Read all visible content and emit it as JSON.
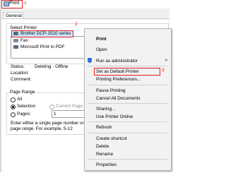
{
  "window": {
    "title": "Print"
  },
  "callouts": {
    "one": "1",
    "two": "2",
    "three": "3"
  },
  "tabs": [
    "General"
  ],
  "select_printer": {
    "label": "Select Printer",
    "items": [
      "Brother DCP-1510 series",
      "Fax",
      "Microsoft Print to PDF"
    ]
  },
  "status": {
    "status_label": "Status:",
    "status_value": "Deleting - Offline",
    "location_label": "Location:",
    "comment_label": "Comment:"
  },
  "page_range": {
    "label": "Page Range",
    "all": "All",
    "selection": "Selection",
    "current_page": "Current Page",
    "pages": "Pages:",
    "pages_value": "1",
    "hint_line1": "Enter either a single page number or a single",
    "hint_line2": "page range.  For example, 5-12"
  },
  "context_menu": {
    "items": [
      "Print",
      "Open",
      "Run as administrator",
      "Set as Default Printer",
      "Printing Preferences...",
      "Pause Printing",
      "Cancel All Documents",
      "Sharing...",
      "Use Printer Online",
      "Refresh",
      "Create shortcut",
      "Delete",
      "Rename",
      "Properties"
    ],
    "submenu_arrow": ">"
  }
}
